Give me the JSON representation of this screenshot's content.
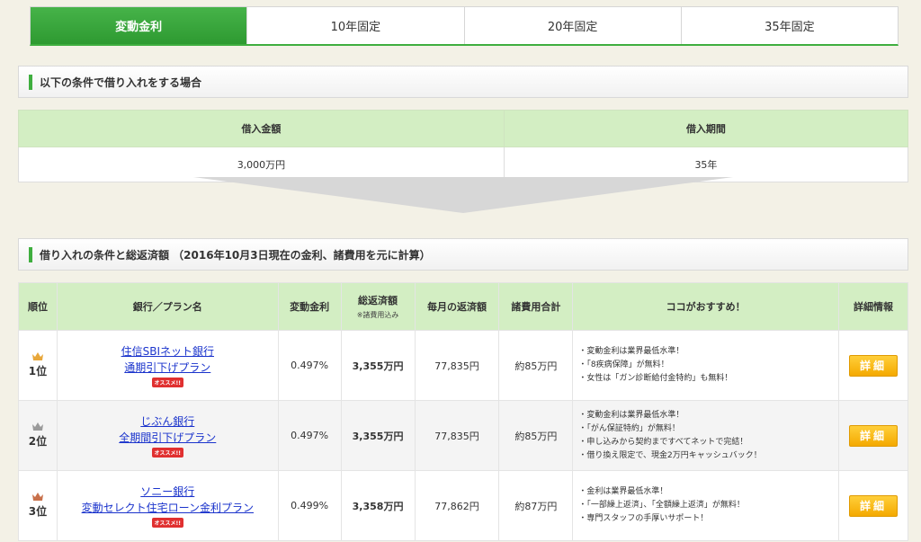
{
  "tabs": [
    "変動金利",
    "10年固定",
    "20年固定",
    "35年固定"
  ],
  "section1_title": "以下の条件で借り入れをする場合",
  "conditions": {
    "headers": [
      "借入金額",
      "借入期間"
    ],
    "values": [
      "3,000万円",
      "35年"
    ]
  },
  "section2_title": "借り入れの条件と総返済額 （2016年10月3日現在の金利、諸費用を元に計算）",
  "table": {
    "headers": {
      "rank": "順位",
      "bank": "銀行／プラン名",
      "rate": "変動金利",
      "total": "総返済額",
      "total_note": "※諸費用込み",
      "monthly": "毎月の返済額",
      "fees": "諸費用合計",
      "recommend": "ココがおすすめ！",
      "detail": "詳細情報"
    },
    "rows": [
      {
        "rank": "1位",
        "bank": "住信SBIネット銀行",
        "plan": "通期引下げプラン",
        "badge": "オススメ!!",
        "rate": "0.497%",
        "total": "3,355万円",
        "monthly": "77,835円",
        "fees": "約85万円",
        "points": [
          "・変動金利は業界最低水準！",
          "・「8疾病保障」が無料！",
          "・女性は「ガン診断給付金特約」も無料！"
        ],
        "detail": "詳細"
      },
      {
        "rank": "2位",
        "bank": "じぶん銀行",
        "plan": "全期間引下げプラン",
        "badge": "オススメ!!",
        "rate": "0.497%",
        "total": "3,355万円",
        "monthly": "77,835円",
        "fees": "約85万円",
        "points": [
          "・変動金利は業界最低水準！",
          "・「がん保証特約」が無料！",
          "・申し込みから契約まですべてネットで完結！",
          "・借り換え限定で、現金2万円キャッシュバック！"
        ],
        "detail": "詳細"
      },
      {
        "rank": "3位",
        "bank": "ソニー銀行",
        "plan": "変動セレクト住宅ローン金利プラン",
        "badge": "オススメ!!",
        "rate": "0.499%",
        "total": "3,358万円",
        "monthly": "77,862円",
        "fees": "約87万円",
        "points": [
          "・金利は業界最低水準！",
          "・「一部繰上返済」、「全額繰上返済」が無料！",
          "・専門スタッフの手厚いサポート！"
        ],
        "detail": "詳細"
      }
    ]
  },
  "colors": {
    "accent_green": "#3fae3f",
    "header_bg": "#d3eec3",
    "total_red": "#e01b1b",
    "button_orange": "#f4a900",
    "crown_gold": "#e8a73a",
    "crown_silver": "#9a9a9a",
    "crown_bronze": "#c8704a"
  }
}
